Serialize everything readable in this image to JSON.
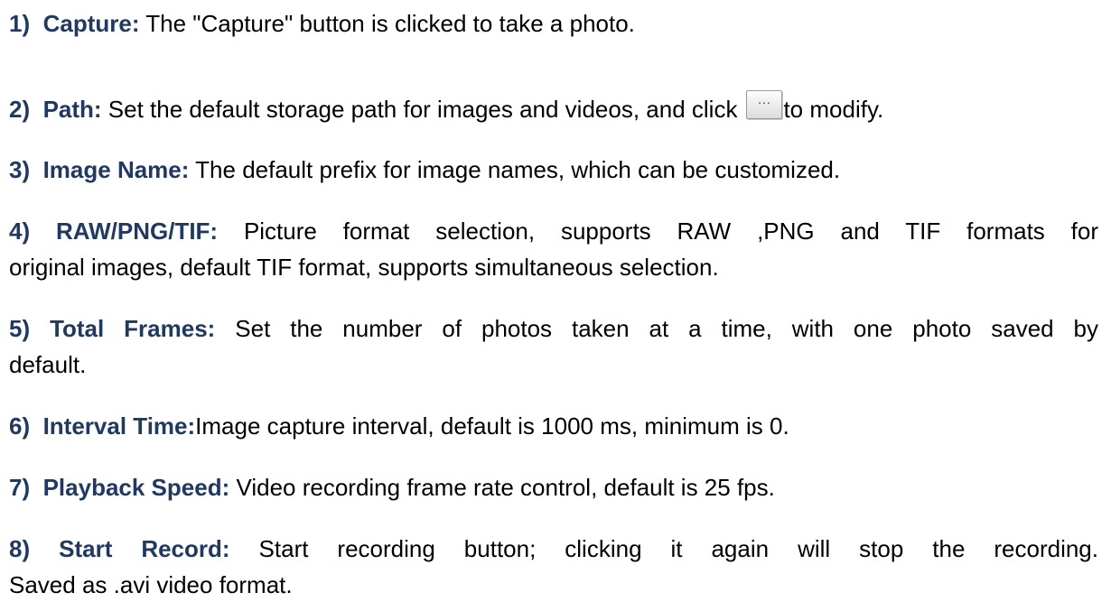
{
  "items": [
    {
      "num": "1)",
      "term": "Capture:",
      "text": " The \"Capture\" button is clicked to take a photo."
    },
    {
      "num": "2)",
      "term": "Path:",
      "text_before": " Set the default storage path for images and videos, and click",
      "button_label": "...",
      "text_after": "to modify."
    },
    {
      "num": "3)",
      "term": "Image Name:",
      "text": " The default prefix for image names, which can be customized."
    },
    {
      "num": "4)",
      "term": "RAW/PNG/TIF:",
      "text_line1": "Picture format selection, supports RAW ,PNG and TIF formats for",
      "text_line2": "original images, default TIF format, supports simultaneous selection."
    },
    {
      "num": "5)",
      "term": "Total Frames:",
      "text_line1": "Set the number of photos taken at a time, with one photo saved by",
      "text_line2": "default."
    },
    {
      "num": "6)",
      "term": "Interval Time:",
      "text": "Image capture interval, default is 1000 ms, minimum is 0."
    },
    {
      "num": "7)",
      "term": "Playback Speed:",
      "text": " Video recording frame rate control, default is 25 fps."
    },
    {
      "num": "8)",
      "term": "Start Record:",
      "text_line1": "Start recording button; clicking it again will stop the recording.",
      "text_line2": "Saved as .avi video format."
    }
  ]
}
